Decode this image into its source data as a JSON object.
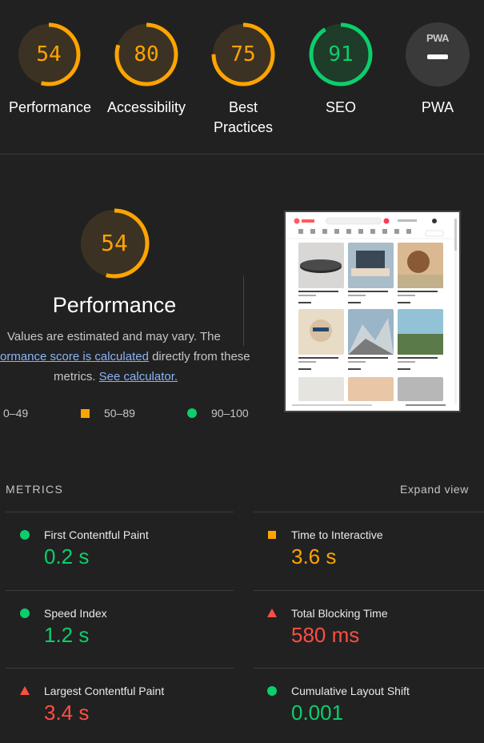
{
  "category_gauges": [
    {
      "label": "Performance",
      "score": "54",
      "color": "#ffa400",
      "fraction": 0.54
    },
    {
      "label": "Accessibility",
      "score": "80",
      "color": "#ffa400",
      "fraction": 0.8
    },
    {
      "label": "Best Practices",
      "score": "75",
      "color": "#ffa400",
      "fraction": 0.75
    },
    {
      "label": "SEO",
      "score": "91",
      "color": "#0cce6b",
      "fraction": 0.91
    },
    {
      "label": "PWA",
      "badge": "PWA"
    }
  ],
  "performance": {
    "score": "54",
    "fraction": 0.54,
    "title": "Performance",
    "desc_line1": "Values are estimated and may vary. The",
    "desc_line2_link": "ormance score is calculated",
    "desc_line2_rest": " directly from these",
    "desc_line3_pre": "metrics. ",
    "desc_line3_link": "See calculator.",
    "legend": [
      {
        "range": "0–49",
        "shape": "triangle"
      },
      {
        "range": "50–89",
        "shape": "square"
      },
      {
        "range": "90–100",
        "shape": "circle"
      }
    ]
  },
  "metrics_section": {
    "title": "METRICS",
    "expand_label": "Expand view",
    "items": [
      {
        "label": "First Contentful Paint",
        "value": "0.2 s",
        "status": "pass"
      },
      {
        "label": "Time to Interactive",
        "value": "3.6 s",
        "status": "average"
      },
      {
        "label": "Speed Index",
        "value": "1.2 s",
        "status": "pass"
      },
      {
        "label": "Total Blocking Time",
        "value": "580 ms",
        "status": "fail"
      },
      {
        "label": "Largest Contentful Paint",
        "value": "3.4 s",
        "status": "fail"
      },
      {
        "label": "Cumulative Layout Shift",
        "value": "0.001",
        "status": "pass"
      }
    ]
  },
  "colors": {
    "pass": "#0cce6b",
    "average": "#ffa400",
    "fail": "#ff4e42",
    "background": "#212121"
  }
}
